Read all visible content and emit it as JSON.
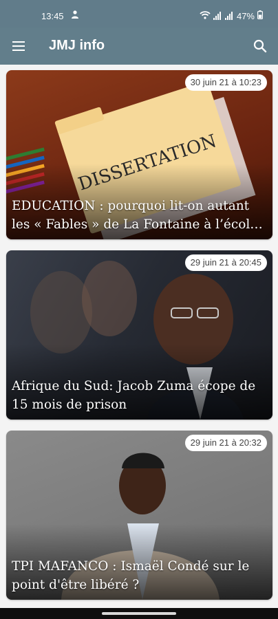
{
  "status_bar": {
    "time": "13:45",
    "battery": "47%",
    "icons": [
      "person-sync-icon",
      "wifi-icon",
      "signal-icon",
      "signal-icon",
      "battery-icon"
    ]
  },
  "app_bar": {
    "title": "JMJ info",
    "menu_icon": "hamburger-menu-icon",
    "search_icon": "search-icon",
    "background": "#627e8b"
  },
  "articles": [
    {
      "date": "30 juin 21 à 10:23",
      "title": "EDUCATION : pourquoi lit-on autant les « Fables » de La Fontaine à l’école ?",
      "image_text": "DISSERTATION"
    },
    {
      "date": "29 juin 21 à 20:45",
      "title": "Afrique du Sud: Jacob Zuma écope de 15 mois de prison"
    },
    {
      "date": "29 juin 21 à 20:32",
      "title": "TPI MAFANCO : Ismaël Condé sur le point d'être libéré ?"
    }
  ]
}
